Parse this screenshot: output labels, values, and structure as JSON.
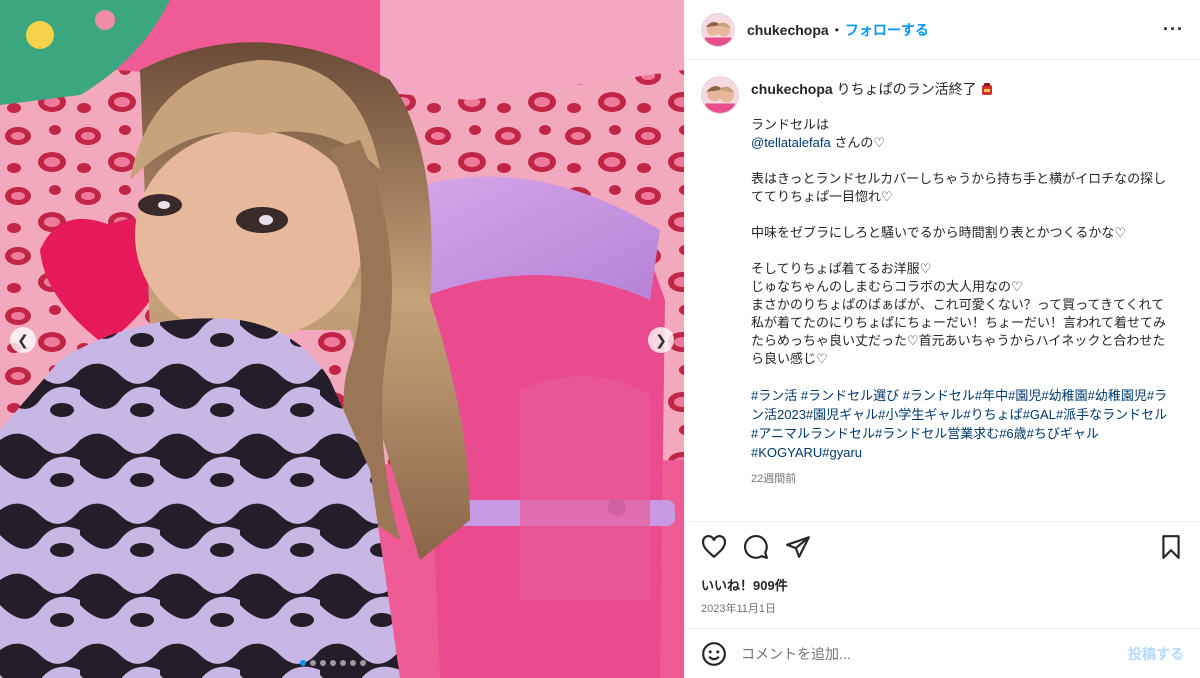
{
  "post": {
    "username": "chukechopa",
    "separator": "•",
    "follow_label": "フォローする",
    "more_label": "···",
    "caption_title": "りちょぱのラン活終了",
    "caption_lines": [
      "ランドセルは",
      "__MENTION__",
      "",
      "表はきっとランドセルカバーしちゃうから持ち手と横がイロチなの探しててりちょぱ一目惚れ♡",
      "",
      "中味をゼブラにしろと騒いでるから時間割り表とかつくるかな♡",
      "",
      "そしてりちょぱ着てるお洋服♡",
      "じゅなちゃんのしまむらコラボの大人用なの♡",
      "まさかのりちょぱのばぁばが、これ可愛くない？って買ってきてくれて私が着てたのにりちょぱにちょーだい！ちょーだい！言われて着せてみたらめっちゃ良い丈だった♡首元あいちゃうからハイネックと合わせたら良い感じ♡",
      ""
    ],
    "mention": "@tellatalefafa",
    "mention_suffix": " さんの♡",
    "hashtags": "#ラン活 #ランドセル選び #ランドセル#年中#園児#幼稚園#幼稚園児#ラン活2023#園児ギャル#小学生ギャル#りちょぱ#GAL#派手なランドセル#アニマルランドセル#ランドセル営業求む#6歳#ちびギャル#KOGYARU#gyaru",
    "time_ago": "22週間前",
    "likes": "いいね！909件",
    "date": "2023年11月1日",
    "comment_placeholder": "コメントを追加...",
    "post_button": "投稿する",
    "carousel": {
      "count": 7,
      "active_index": 0
    }
  },
  "icons": {
    "like": "heart-icon",
    "comment": "comment-icon",
    "share": "share-icon",
    "save": "bookmark-icon",
    "emoji": "emoji-icon",
    "prev": "chevron-left-icon",
    "next": "chevron-right-icon"
  },
  "colors": {
    "accent": "#0095f6",
    "link": "#00376b",
    "muted": "#737373"
  }
}
